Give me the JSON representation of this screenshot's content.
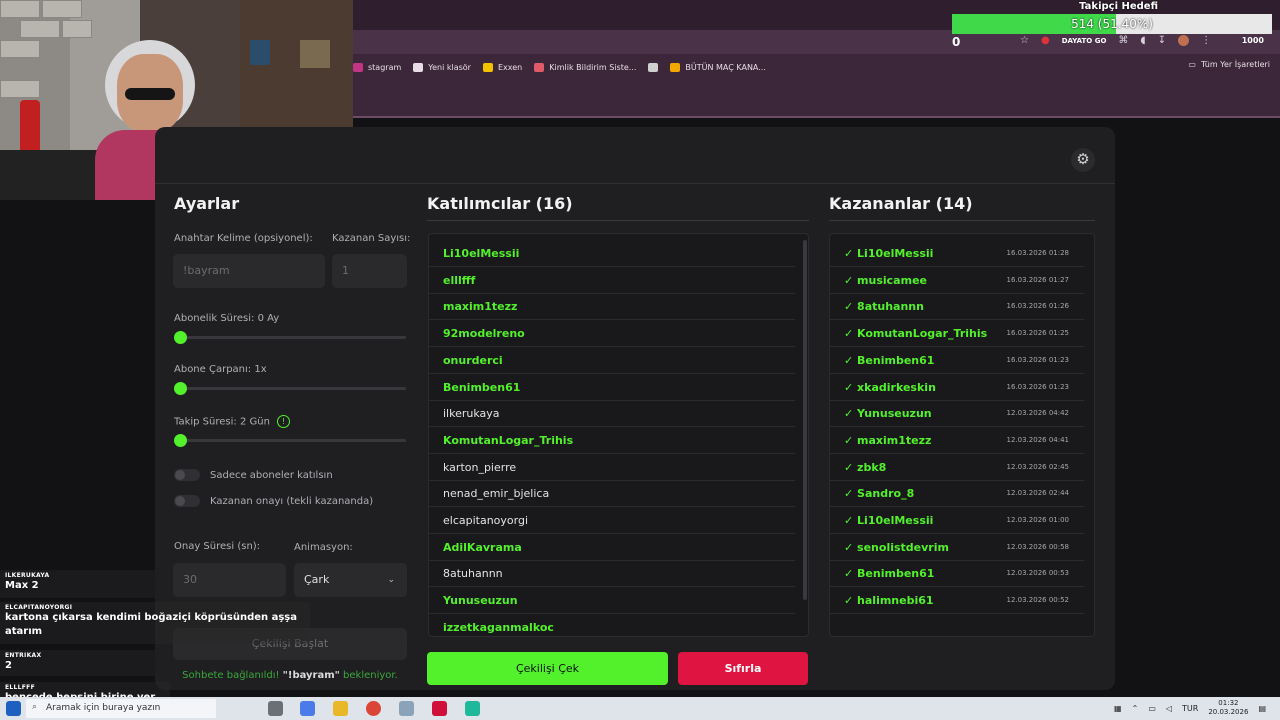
{
  "goal": {
    "title": "Takipçi Hedefi",
    "progress_text": "514 (51.40%)",
    "progress_fraction": 0.514,
    "min_label": "0",
    "max_label": "1000"
  },
  "browser": {
    "extension_label": "DAYATO GO",
    "bookmarks": [
      {
        "label": "stagram",
        "icon": "instagram-icon",
        "color": "#c13584"
      },
      {
        "label": "Yeni klasör",
        "icon": "folder-icon",
        "color": "#e8dde6"
      },
      {
        "label": "Exxen",
        "icon": "exxen-icon",
        "color": "#f2c200"
      },
      {
        "label": "Kimlik Bildirim Siste...",
        "icon": "feather-icon",
        "color": "#e05a6a"
      },
      {
        "label": "",
        "icon": "globe-icon",
        "color": "#cfcfcf"
      },
      {
        "label": "BÜTÜN MAÇ KANA...",
        "icon": "tv-icon",
        "color": "#f2a800"
      }
    ],
    "all_bookmarks_label": "Tüm Yer İşaretleri"
  },
  "settings": {
    "title": "Ayarlar",
    "keyword_label": "Anahtar Kelime (opsiyonel):",
    "keyword_placeholder": "!bayram",
    "winner_count_label": "Kazanan Sayısı:",
    "winner_count_placeholder": "1",
    "sub_duration_label": "Abonelik Süresi: 0 Ay",
    "sub_duration_value": 0,
    "sub_multiplier_label": "Abone Çarpanı: 1x",
    "sub_multiplier_value": 1,
    "follow_duration_label": "Takip Süresi:  2  Gün",
    "follow_duration_value": 2,
    "only_subs_label": "Sadece aboneler katılsın",
    "winner_confirm_label": "Kazanan onayı (tekli kazananda)",
    "confirm_time_label": "Onay Süresi (sn):",
    "confirm_time_value": "30",
    "animation_label": "Animasyon:",
    "animation_value": "Çark",
    "start_button": "Çekilişi Başlat",
    "status_prefix": "Sohbete bağlanıldı! ",
    "status_keyword": "\"!bayram\"",
    "status_suffix": " bekleniyor."
  },
  "participants": {
    "title": "Katılımcılar (16)",
    "items": [
      {
        "name": "Li10elMessii",
        "highlight": true
      },
      {
        "name": "elllfff",
        "highlight": true
      },
      {
        "name": "maxim1tezz",
        "highlight": true
      },
      {
        "name": "92modelreno",
        "highlight": true
      },
      {
        "name": "onurderci",
        "highlight": true
      },
      {
        "name": "Benimben61",
        "highlight": true
      },
      {
        "name": "ilkerukaya",
        "highlight": false
      },
      {
        "name": "KomutanLogar_Trihis",
        "highlight": true
      },
      {
        "name": "karton_pierre",
        "highlight": false
      },
      {
        "name": "nenad_emir_bjelica",
        "highlight": false
      },
      {
        "name": "elcapitanoyorgi",
        "highlight": false
      },
      {
        "name": "AdilKavrama",
        "highlight": true
      },
      {
        "name": "8atuhannn",
        "highlight": false
      },
      {
        "name": "Yunuseuzun",
        "highlight": true
      },
      {
        "name": "izzetkaganmalkoc",
        "highlight": true
      }
    ]
  },
  "winners": {
    "title": "Kazananlar (14)",
    "items": [
      {
        "name": "✓ Li10elMessii",
        "date": "16.03.2026 01:28"
      },
      {
        "name": "✓ musicamee",
        "date": "16.03.2026 01:27"
      },
      {
        "name": "✓ 8atuhannn",
        "date": "16.03.2026 01:26"
      },
      {
        "name": "✓ KomutanLogar_Trihis",
        "date": "16.03.2026 01:25"
      },
      {
        "name": "✓ Benimben61",
        "date": "16.03.2026 01:23"
      },
      {
        "name": "✓ xkadirkeskin",
        "date": "16.03.2026 01:23"
      },
      {
        "name": "✓ Yunuseuzun",
        "date": "12.03.2026 04:42"
      },
      {
        "name": "✓ maxim1tezz",
        "date": "12.03.2026 04:41"
      },
      {
        "name": "✓ zbk8",
        "date": "12.03.2026 02:45"
      },
      {
        "name": "✓ Sandro_8",
        "date": "12.03.2026 02:44"
      },
      {
        "name": "✓ Li10elMessii",
        "date": "12.03.2026 01:00"
      },
      {
        "name": "✓ senolistdevrim",
        "date": "12.03.2026 00:58"
      },
      {
        "name": "✓ Benimben61",
        "date": "12.03.2026 00:53"
      },
      {
        "name": "✓ halimnebi61",
        "date": "12.03.2026 00:52"
      }
    ]
  },
  "actions": {
    "draw_button": "Çekilişi Çek",
    "reset_button": "Sıfırla"
  },
  "chat": [
    {
      "user": "ILKERUKAYA",
      "text": "Max 2"
    },
    {
      "user": "ELCAPITANOYORGI",
      "text": "kartona çıkarsa kendimi boğaziçi köprüsünden aşşa atarım"
    },
    {
      "user": "ENTRIKAX",
      "text": "2"
    },
    {
      "user": "ELLLFFF",
      "text": "bencede hepsini birine ver"
    }
  ],
  "taskbar": {
    "search_placeholder": "Aramak için buraya yazın",
    "language": "TUR",
    "time": "01:32",
    "date": "20.03.2026"
  },
  "colors": {
    "accent_green": "#53f02c",
    "reset_red": "#e01440",
    "card_bg": "#1f1f22"
  }
}
